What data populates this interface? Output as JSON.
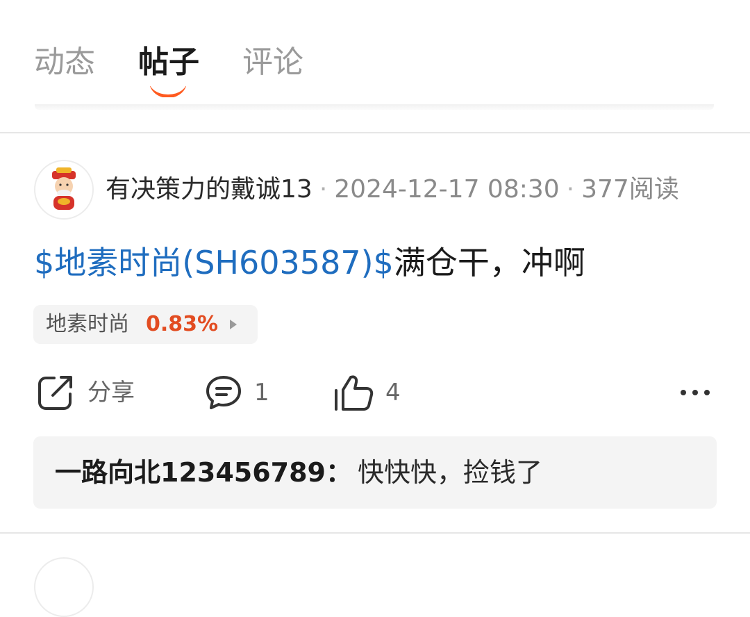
{
  "tabs": {
    "items": [
      {
        "label": "动态"
      },
      {
        "label": "帖子"
      },
      {
        "label": "评论"
      }
    ],
    "active": "帖子"
  },
  "post": {
    "author": "有决策力的戴诚13",
    "date": "2024-12-17 08:30",
    "reads": "377阅读",
    "separator": "·",
    "stock_tag": "$地素时尚(SH603587)$",
    "text": "满仓干，冲啊",
    "stock_chip": {
      "name": "地素时尚",
      "change": "0.83%"
    },
    "actions": {
      "share_label": "分享",
      "comment_count": "1",
      "like_count": "4"
    },
    "reply": {
      "user": "一路向北123456789：",
      "text": "快快快，捡钱了"
    }
  },
  "colors": {
    "accent": "#ff5a1f",
    "stock_link": "#1f6dbf",
    "positive_change": "#e24c21"
  },
  "icons": [
    "share-icon",
    "comment-icon",
    "like-icon",
    "more-icon",
    "avatar-icon",
    "arrow-right-icon"
  ]
}
